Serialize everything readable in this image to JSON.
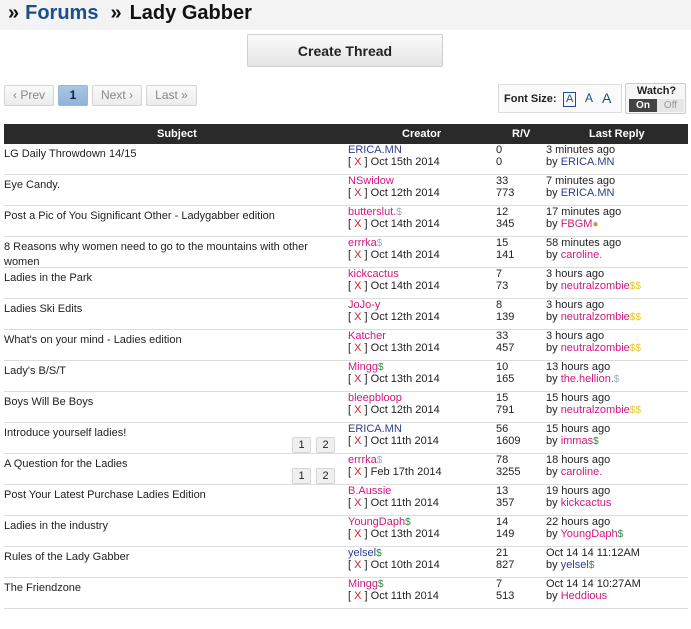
{
  "breadcrumb": {
    "prefix": "»",
    "forums": "Forums",
    "separator": "»",
    "current": "Lady Gabber"
  },
  "create_button": "Create Thread",
  "pagination": {
    "prev": "‹ Prev",
    "page": "1",
    "next": "Next ›",
    "last": "Last »"
  },
  "font_size": {
    "label": "Font Size:",
    "small": "A",
    "medium": "A",
    "large": "A"
  },
  "watch": {
    "label": "Watch?",
    "on": "On",
    "off": "Off"
  },
  "table": {
    "headers": {
      "subject": "Subject",
      "creator": "Creator",
      "rv": "R/V",
      "last_reply": "Last Reply"
    },
    "close_mark": "X",
    "rows": [
      {
        "subject": "LG Daily Throwdown 14/15",
        "creator": "ERICA.MN",
        "creator_color": "#2a3f8f",
        "creator_mark": "",
        "date": "Oct 15th 2014",
        "replies": "0",
        "views": "0",
        "last_time": "3 minutes ago",
        "last_by": "ERICA.MN",
        "last_by_color": "#2a3f8f",
        "last_mark": "",
        "pages": []
      },
      {
        "subject": "Eye Candy.",
        "creator": "NSwidow",
        "creator_color": "#d1177e",
        "creator_mark": "",
        "date": "Oct 12th 2014",
        "replies": "33",
        "views": "773",
        "last_time": "7 minutes ago",
        "last_by": "ERICA.MN",
        "last_by_color": "#2a3f8f",
        "last_mark": "",
        "pages": []
      },
      {
        "subject": "Post a Pic of You Significant Other - Ladygabber edition",
        "creator": "butterslut.",
        "creator_color": "#d1177e",
        "creator_mark": "$",
        "creator_mark_color": "#9aa9c9",
        "date": "Oct 14th 2014",
        "replies": "12",
        "views": "345",
        "last_time": "17 minutes ago",
        "last_by": "FBGM",
        "last_by_color": "#d1177e",
        "last_mark": "●",
        "last_mark_color": "#c99a3a",
        "pages": []
      },
      {
        "subject": "8 Reasons why women need to go to the mountains with other women",
        "creator": "errrka",
        "creator_color": "#d1177e",
        "creator_mark": "$",
        "creator_mark_color": "#9aa9c9",
        "date": "Oct 14th 2014",
        "replies": "15",
        "views": "141",
        "last_time": "58 minutes ago",
        "last_by": "caroline.",
        "last_by_color": "#d1177e",
        "last_mark": "",
        "pages": []
      },
      {
        "subject": "Ladies in the Park",
        "creator": "kickcactus",
        "creator_color": "#d1177e",
        "creator_mark": "",
        "date": "Oct 14th 2014",
        "replies": "7",
        "views": "73",
        "last_time": "3 hours ago",
        "last_by": "neutralzombie",
        "last_by_color": "#d1177e",
        "last_mark": "$$",
        "last_mark_color": "#e6c82a",
        "pages": []
      },
      {
        "subject": "Ladies Ski Edits",
        "creator": "JoJo-y",
        "creator_color": "#d1177e",
        "creator_mark": "",
        "date": "Oct 12th 2014",
        "replies": "8",
        "views": "139",
        "last_time": "3 hours ago",
        "last_by": "neutralzombie",
        "last_by_color": "#d1177e",
        "last_mark": "$$",
        "last_mark_color": "#e6c82a",
        "pages": []
      },
      {
        "subject": "What's on your mind - Ladies edition",
        "creator": "Katcher",
        "creator_color": "#d1177e",
        "creator_mark": "",
        "date": "Oct 13th 2014",
        "replies": "33",
        "views": "457",
        "last_time": "3 hours ago",
        "last_by": "neutralzombie",
        "last_by_color": "#d1177e",
        "last_mark": "$$",
        "last_mark_color": "#e6c82a",
        "pages": []
      },
      {
        "subject": "Lady's B/S/T",
        "creator": "Mingg",
        "creator_color": "#d1177e",
        "creator_mark": "$",
        "creator_mark_color": "#2e8b3a",
        "date": "Oct 13th 2014",
        "replies": "10",
        "views": "165",
        "last_time": "13 hours ago",
        "last_by": "the.hellion.",
        "last_by_color": "#d1177e",
        "last_mark": "$",
        "last_mark_color": "#9aa9c9",
        "pages": []
      },
      {
        "subject": "Boys Will Be Boys",
        "creator": "bleepbloop",
        "creator_color": "#d1177e",
        "creator_mark": "",
        "date": "Oct 12th 2014",
        "replies": "15",
        "views": "791",
        "last_time": "15 hours ago",
        "last_by": "neutralzombie",
        "last_by_color": "#d1177e",
        "last_mark": "$$",
        "last_mark_color": "#e6c82a",
        "pages": []
      },
      {
        "subject": "Introduce yourself ladies!",
        "creator": "ERICA.MN",
        "creator_color": "#2a3f8f",
        "creator_mark": "",
        "date": "Oct 11th 2014",
        "replies": "56",
        "views": "1609",
        "last_time": "15 hours ago",
        "last_by": "immas",
        "last_by_color": "#d1177e",
        "last_mark": "$",
        "last_mark_color": "#2e8b3a",
        "pages": [
          "1",
          "2"
        ]
      },
      {
        "subject": "A Question for the Ladies",
        "creator": "errrka",
        "creator_color": "#d1177e",
        "creator_mark": "$",
        "creator_mark_color": "#9aa9c9",
        "date": "Feb 17th 2014",
        "replies": "78",
        "views": "3255",
        "last_time": "18 hours ago",
        "last_by": "caroline.",
        "last_by_color": "#d1177e",
        "last_mark": "",
        "pages": [
          "1",
          "2"
        ]
      },
      {
        "subject": "Post Your Latest Purchase Ladies Edition",
        "creator": "B.Aussie",
        "creator_color": "#d1177e",
        "creator_mark": "",
        "date": "Oct 11th 2014",
        "replies": "13",
        "views": "357",
        "last_time": "19 hours ago",
        "last_by": "kickcactus",
        "last_by_color": "#d1177e",
        "last_mark": "",
        "pages": []
      },
      {
        "subject": "Ladies in the industry",
        "creator": "YoungDaph",
        "creator_color": "#d1177e",
        "creator_mark": "$",
        "creator_mark_color": "#2e8b3a",
        "date": "Oct 13th 2014",
        "replies": "14",
        "views": "149",
        "last_time": "22 hours ago",
        "last_by": "YoungDaph",
        "last_by_color": "#d1177e",
        "last_mark": "$",
        "last_mark_color": "#2e8b3a",
        "pages": []
      },
      {
        "subject": "Rules of the Lady Gabber",
        "creator": "yelsel",
        "creator_color": "#2a3f8f",
        "creator_mark": "$",
        "creator_mark_color": "#2e8b3a",
        "date": "Oct 10th 2014",
        "replies": "21",
        "views": "827",
        "last_time": "Oct 14 14 11:12AM",
        "last_by": "yelsel",
        "last_by_color": "#2a3f8f",
        "last_mark": "$",
        "last_mark_color": "#2e8b3a",
        "pages": []
      },
      {
        "subject": "The Friendzone",
        "creator": "Mingg",
        "creator_color": "#d1177e",
        "creator_mark": "$",
        "creator_mark_color": "#2e8b3a",
        "date": "Oct 11th 2014",
        "replies": "7",
        "views": "513",
        "last_time": "Oct 14 14 10:27AM",
        "last_by": "Heddious",
        "last_by_color": "#d1177e",
        "last_mark": "",
        "pages": []
      }
    ]
  }
}
